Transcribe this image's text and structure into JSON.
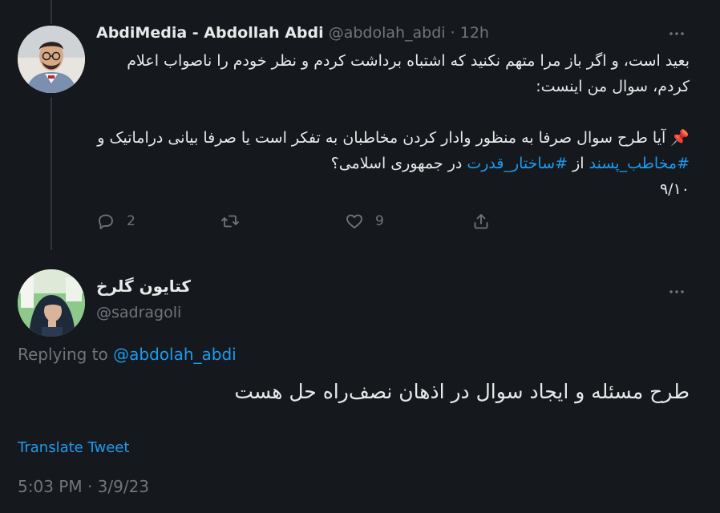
{
  "tweet1": {
    "display_name": "AbdiMedia - Abdollah Abdi",
    "handle": "@abdolah_abdi",
    "separator": "·",
    "time": "12h",
    "more_icon": "more-icon",
    "line1": "بعید است، و اگر باز مرا متهم نکنید که اشتباه برداشت کردم و نظر خودم را ناصواب اعلام کردم، سوال من اینست:",
    "line2_prefix": "📌 آیا طرح سوال صرفا به منظور وادار کردن مخاطبان به تفکر است یا صرفا بیانی دراماتیک و ",
    "hashtag1": "#مخاطب_پسند",
    "line2_mid": " از ",
    "hashtag2": "#ساختار_قدرت",
    "line2_suffix": " در جمهوری اسلامی؟",
    "line3": "۹/۱۰",
    "actions": {
      "reply_count": "2",
      "retweet_count": "",
      "like_count": "9",
      "share_count": ""
    }
  },
  "tweet2": {
    "display_name": "کتایون گلرخ",
    "handle": "@sadragoli",
    "replying_prefix": "Replying to ",
    "replying_to": "@abdolah_abdi",
    "text": "طرح مسئله و ایجاد سوال در اذهان نصف‌راه حل هست",
    "translate_label": "Translate Tweet",
    "timestamp": "5:03 PM · 3/9/23"
  },
  "colors": {
    "background": "#15181c",
    "text": "#e7e9ea",
    "muted": "#71767b",
    "link": "#1d9bf0"
  }
}
